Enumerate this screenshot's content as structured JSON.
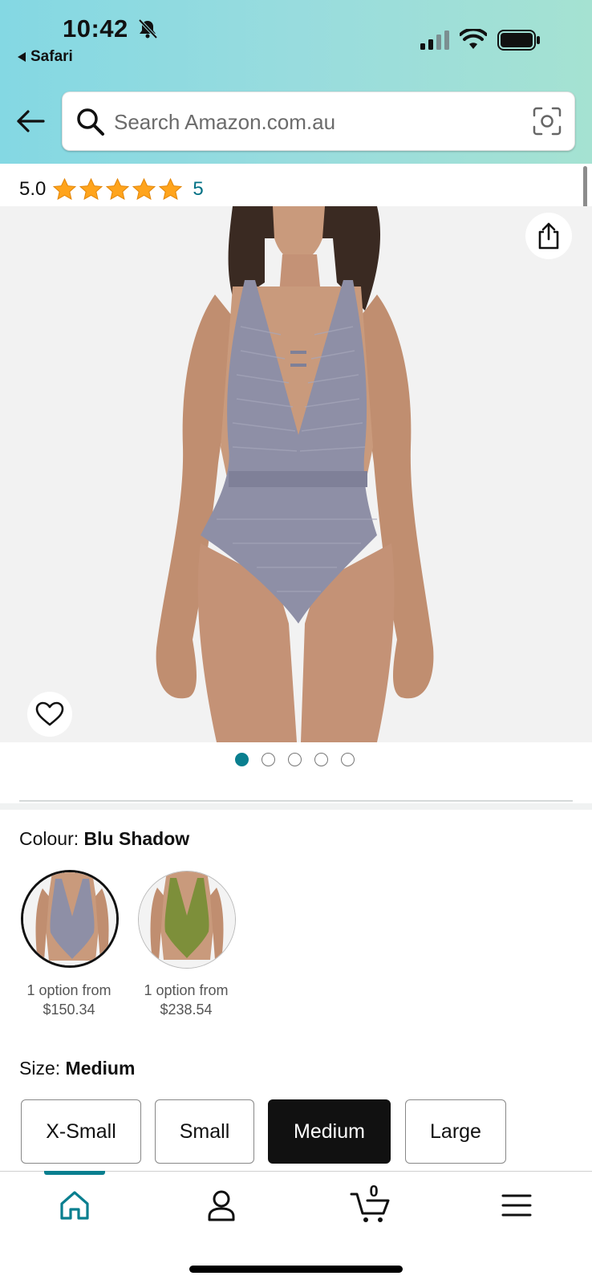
{
  "status_bar": {
    "time": "10:42",
    "back_app": "Safari",
    "icons": [
      "bell-slash-icon",
      "cellular-signal-icon",
      "wifi-icon",
      "battery-icon"
    ]
  },
  "search": {
    "placeholder": "Search Amazon.com.au",
    "icons": [
      "back-arrow-icon",
      "search-icon",
      "camera-scan-icon"
    ]
  },
  "rating": {
    "score": "5.0",
    "stars": 5,
    "count": "5"
  },
  "carousel": {
    "total_images": 5,
    "active_index": 0,
    "icons": [
      "share-icon",
      "heart-icon"
    ]
  },
  "colour": {
    "label": "Colour: ",
    "selected": "Blu Shadow",
    "options": [
      {
        "line1": "1 option from",
        "price": "$150.34",
        "color": "#8e8fa6"
      },
      {
        "line1": "1 option from",
        "price": "$238.54",
        "color": "#7d8f3a"
      }
    ]
  },
  "size": {
    "label": "Size: ",
    "selected": "Medium",
    "options": [
      "X-Small",
      "Small",
      "Medium",
      "Large"
    ]
  },
  "bottom_nav": {
    "cart_count": "0",
    "items": [
      "home-icon",
      "account-icon",
      "cart-icon",
      "menu-icon"
    ],
    "accent": "#0a7f8f"
  },
  "colors": {
    "link": "#007185",
    "star": "#ffa41c",
    "header_gradient_start": "#84d8e3",
    "header_gradient_end": "#a5e2d2"
  }
}
